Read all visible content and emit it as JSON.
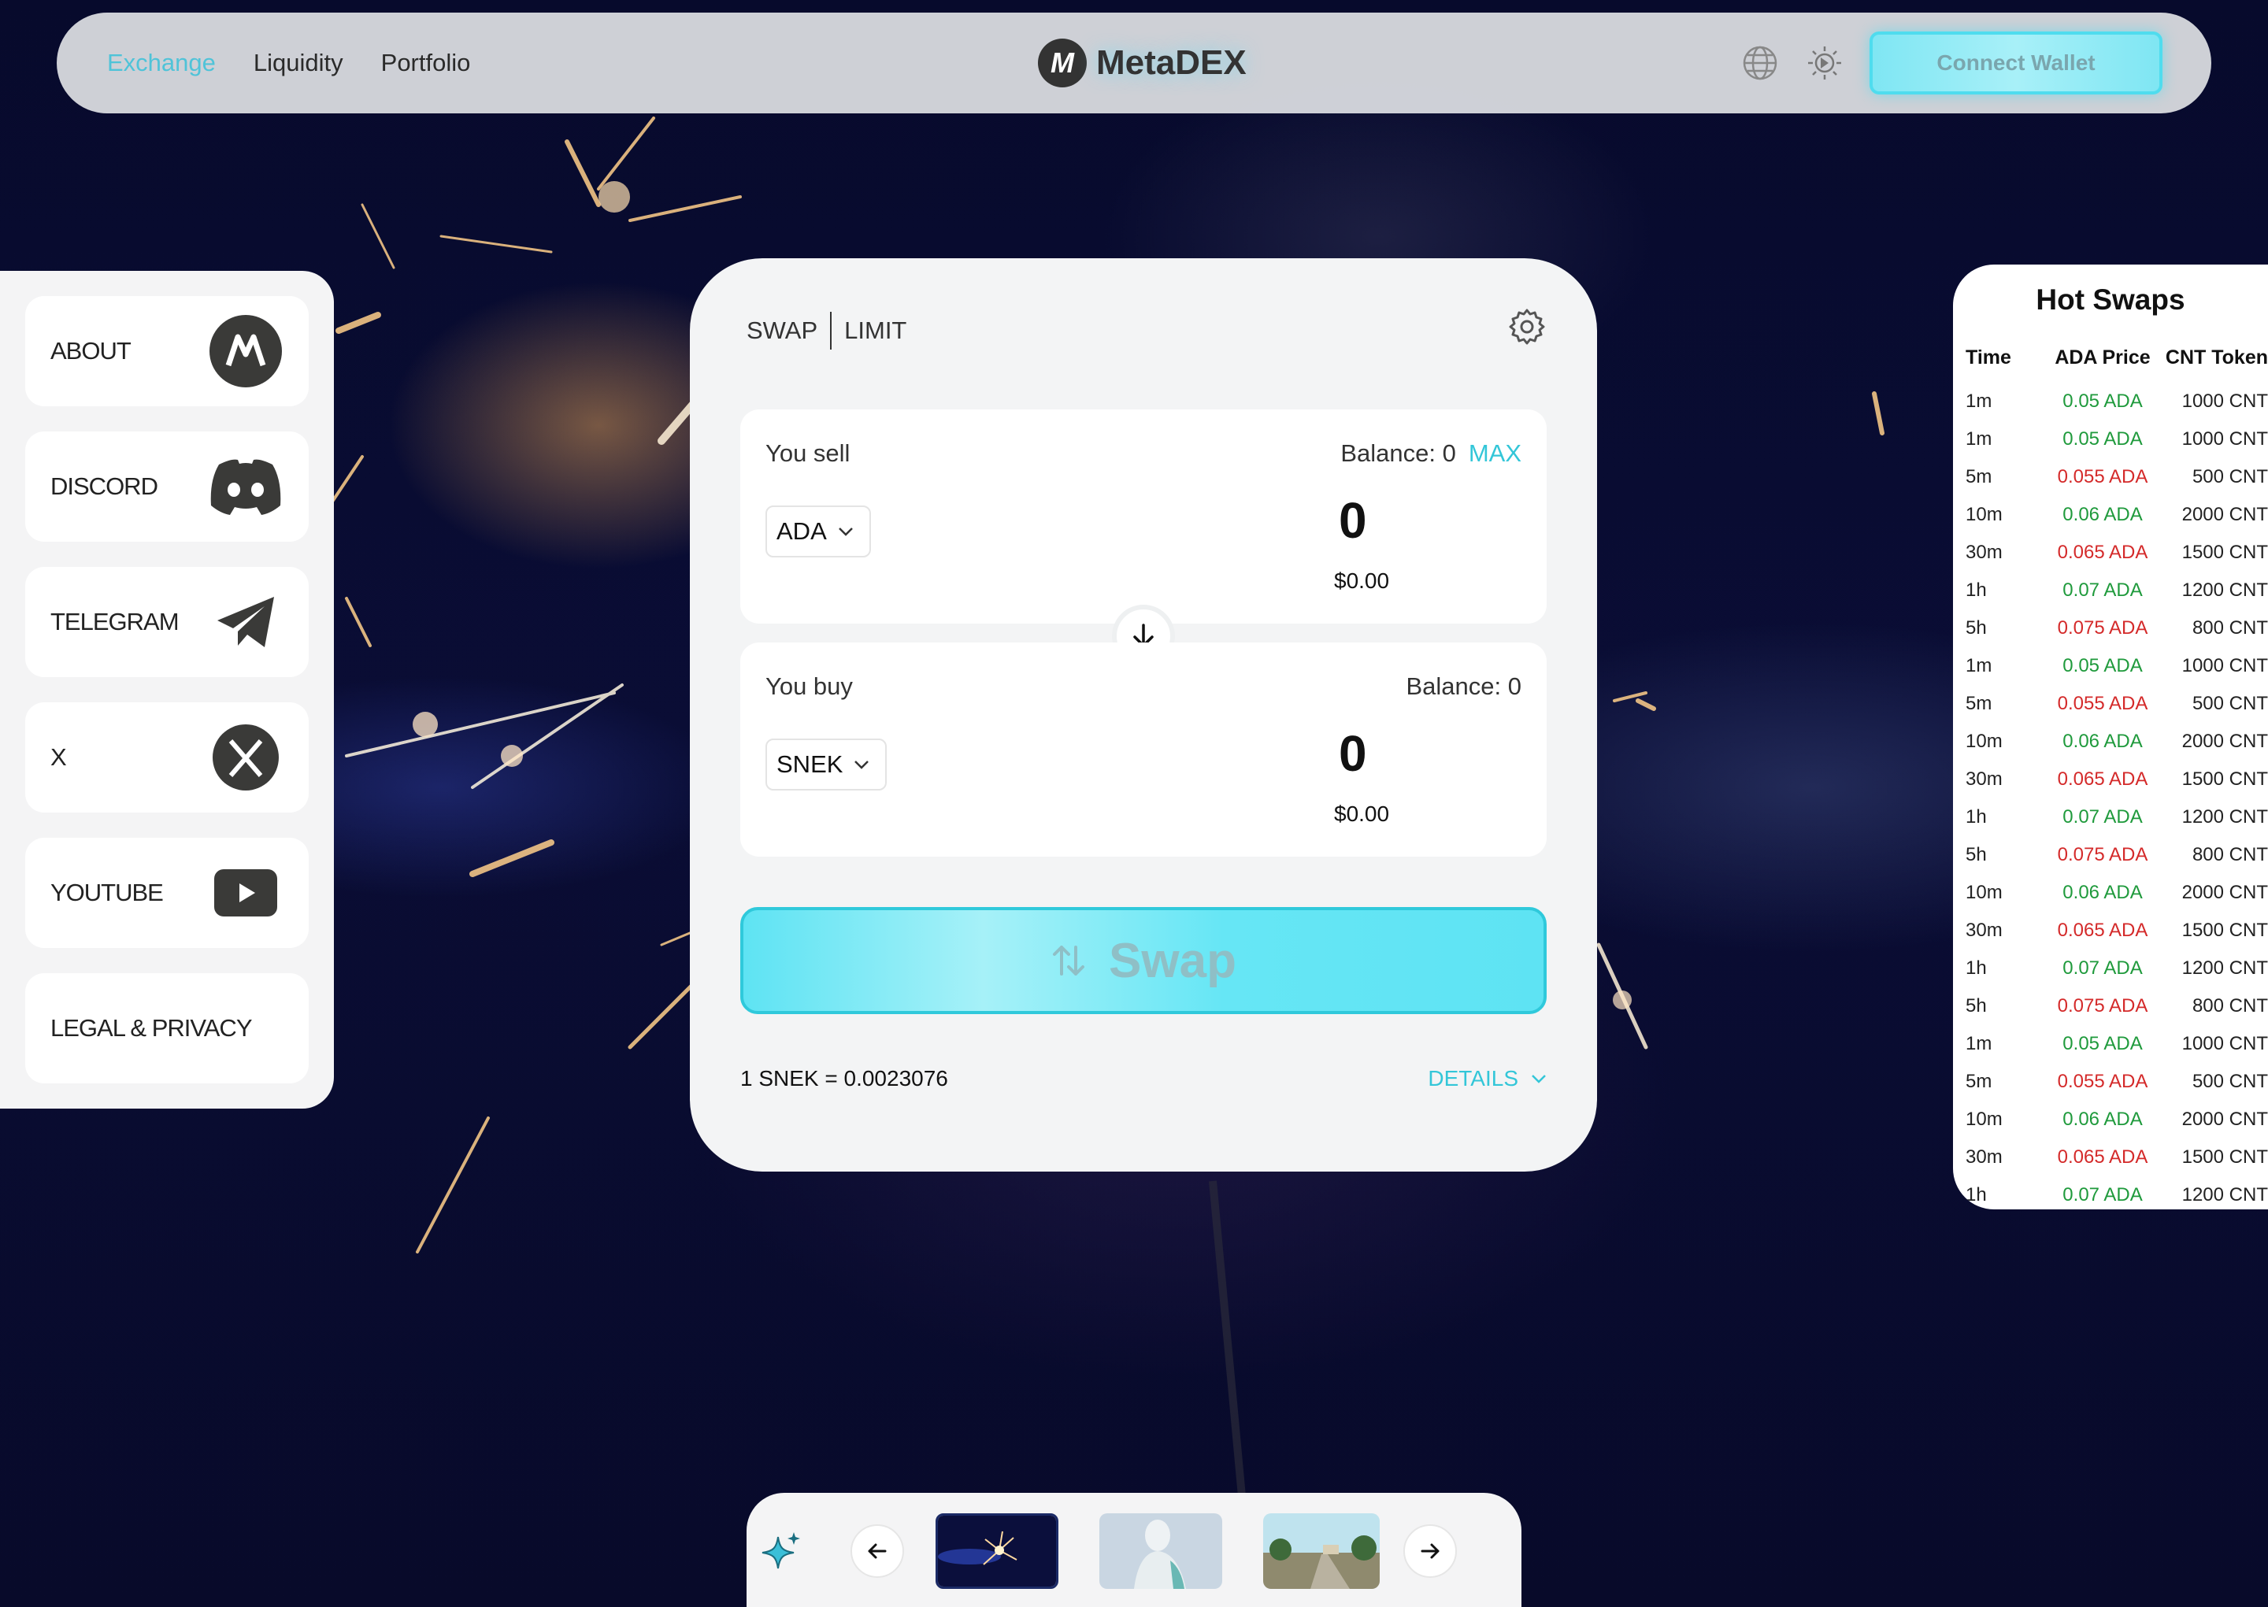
{
  "nav": {
    "links": [
      "Exchange",
      "Liquidity",
      "Portfolio"
    ],
    "active": "Exchange",
    "brand_mark": "M",
    "brand_name": "MetaDEX",
    "connect_label": "Connect Wallet",
    "icons": [
      "globe-icon",
      "theme-sun-icon"
    ]
  },
  "social": {
    "items": [
      {
        "label": "ABOUT",
        "icon": "metadex-logo-icon"
      },
      {
        "label": "DISCORD",
        "icon": "discord-icon"
      },
      {
        "label": "TELEGRAM",
        "icon": "telegram-icon"
      },
      {
        "label": "X",
        "icon": "x-logo-icon"
      },
      {
        "label": "YOUTUBE",
        "icon": "youtube-icon"
      },
      {
        "label": "LEGAL & PRIVACY",
        "icon": ""
      }
    ]
  },
  "swap": {
    "tab_swap": "SWAP",
    "tab_limit": "LIMIT",
    "sell": {
      "label": "You sell",
      "balance": "Balance: 0",
      "max": "MAX",
      "token": "ADA",
      "amount": "0",
      "usd": "$0.00"
    },
    "buy": {
      "label": "You buy",
      "balance": "Balance: 0",
      "token": "SNEK",
      "amount": "0",
      "usd": "$0.00"
    },
    "button_label": "Swap",
    "rate": "1 SNEK = 0.0023076",
    "details": "DETAILS"
  },
  "hot_swaps": {
    "title": "Hot Swaps",
    "headers": [
      "Time",
      "ADA Price",
      "CNT Token"
    ],
    "rows": [
      {
        "time": "1m",
        "price": "0.05 ADA",
        "cnt": "1000 CNT",
        "trend": "up"
      },
      {
        "time": "1m",
        "price": "0.05 ADA",
        "cnt": "1000 CNT",
        "trend": "up"
      },
      {
        "time": "5m",
        "price": "0.055 ADA",
        "cnt": "500 CNT",
        "trend": "down"
      },
      {
        "time": "10m",
        "price": "0.06 ADA",
        "cnt": "2000 CNT",
        "trend": "up"
      },
      {
        "time": "30m",
        "price": "0.065 ADA",
        "cnt": "1500 CNT",
        "trend": "down"
      },
      {
        "time": "1h",
        "price": "0.07 ADA",
        "cnt": "1200 CNT",
        "trend": "up"
      },
      {
        "time": "5h",
        "price": "0.075 ADA",
        "cnt": "800 CNT",
        "trend": "down"
      },
      {
        "time": "1m",
        "price": "0.05 ADA",
        "cnt": "1000 CNT",
        "trend": "up"
      },
      {
        "time": "5m",
        "price": "0.055 ADA",
        "cnt": "500 CNT",
        "trend": "down"
      },
      {
        "time": "10m",
        "price": "0.06 ADA",
        "cnt": "2000 CNT",
        "trend": "up"
      },
      {
        "time": "30m",
        "price": "0.065 ADA",
        "cnt": "1500 CNT",
        "trend": "down"
      },
      {
        "time": "1h",
        "price": "0.07 ADA",
        "cnt": "1200 CNT",
        "trend": "up"
      },
      {
        "time": "5h",
        "price": "0.075 ADA",
        "cnt": "800 CNT",
        "trend": "down"
      },
      {
        "time": "10m",
        "price": "0.06 ADA",
        "cnt": "2000 CNT",
        "trend": "up"
      },
      {
        "time": "30m",
        "price": "0.065 ADA",
        "cnt": "1500 CNT",
        "trend": "down"
      },
      {
        "time": "1h",
        "price": "0.07 ADA",
        "cnt": "1200 CNT",
        "trend": "up"
      },
      {
        "time": "5h",
        "price": "0.075 ADA",
        "cnt": "800 CNT",
        "trend": "down"
      },
      {
        "time": "1m",
        "price": "0.05 ADA",
        "cnt": "1000 CNT",
        "trend": "up"
      },
      {
        "time": "5m",
        "price": "0.055 ADA",
        "cnt": "500 CNT",
        "trend": "down"
      },
      {
        "time": "10m",
        "price": "0.06 ADA",
        "cnt": "2000 CNT",
        "trend": "up"
      },
      {
        "time": "30m",
        "price": "0.065 ADA",
        "cnt": "1500 CNT",
        "trend": "down"
      },
      {
        "time": "1h",
        "price": "0.07 ADA",
        "cnt": "1200 CNT",
        "trend": "up"
      }
    ]
  },
  "gallery": {
    "icons": [
      "sparkle-icon",
      "arrow-left-icon",
      "arrow-right-icon"
    ],
    "thumbnails": [
      "sparkler-thumbnail",
      "statue-thumbnail",
      "road-thumbnail"
    ]
  },
  "colors": {
    "accent": "#33c6d8",
    "up": "#1f9a3c",
    "down": "#d42a2a",
    "background": "#0a0d35"
  }
}
